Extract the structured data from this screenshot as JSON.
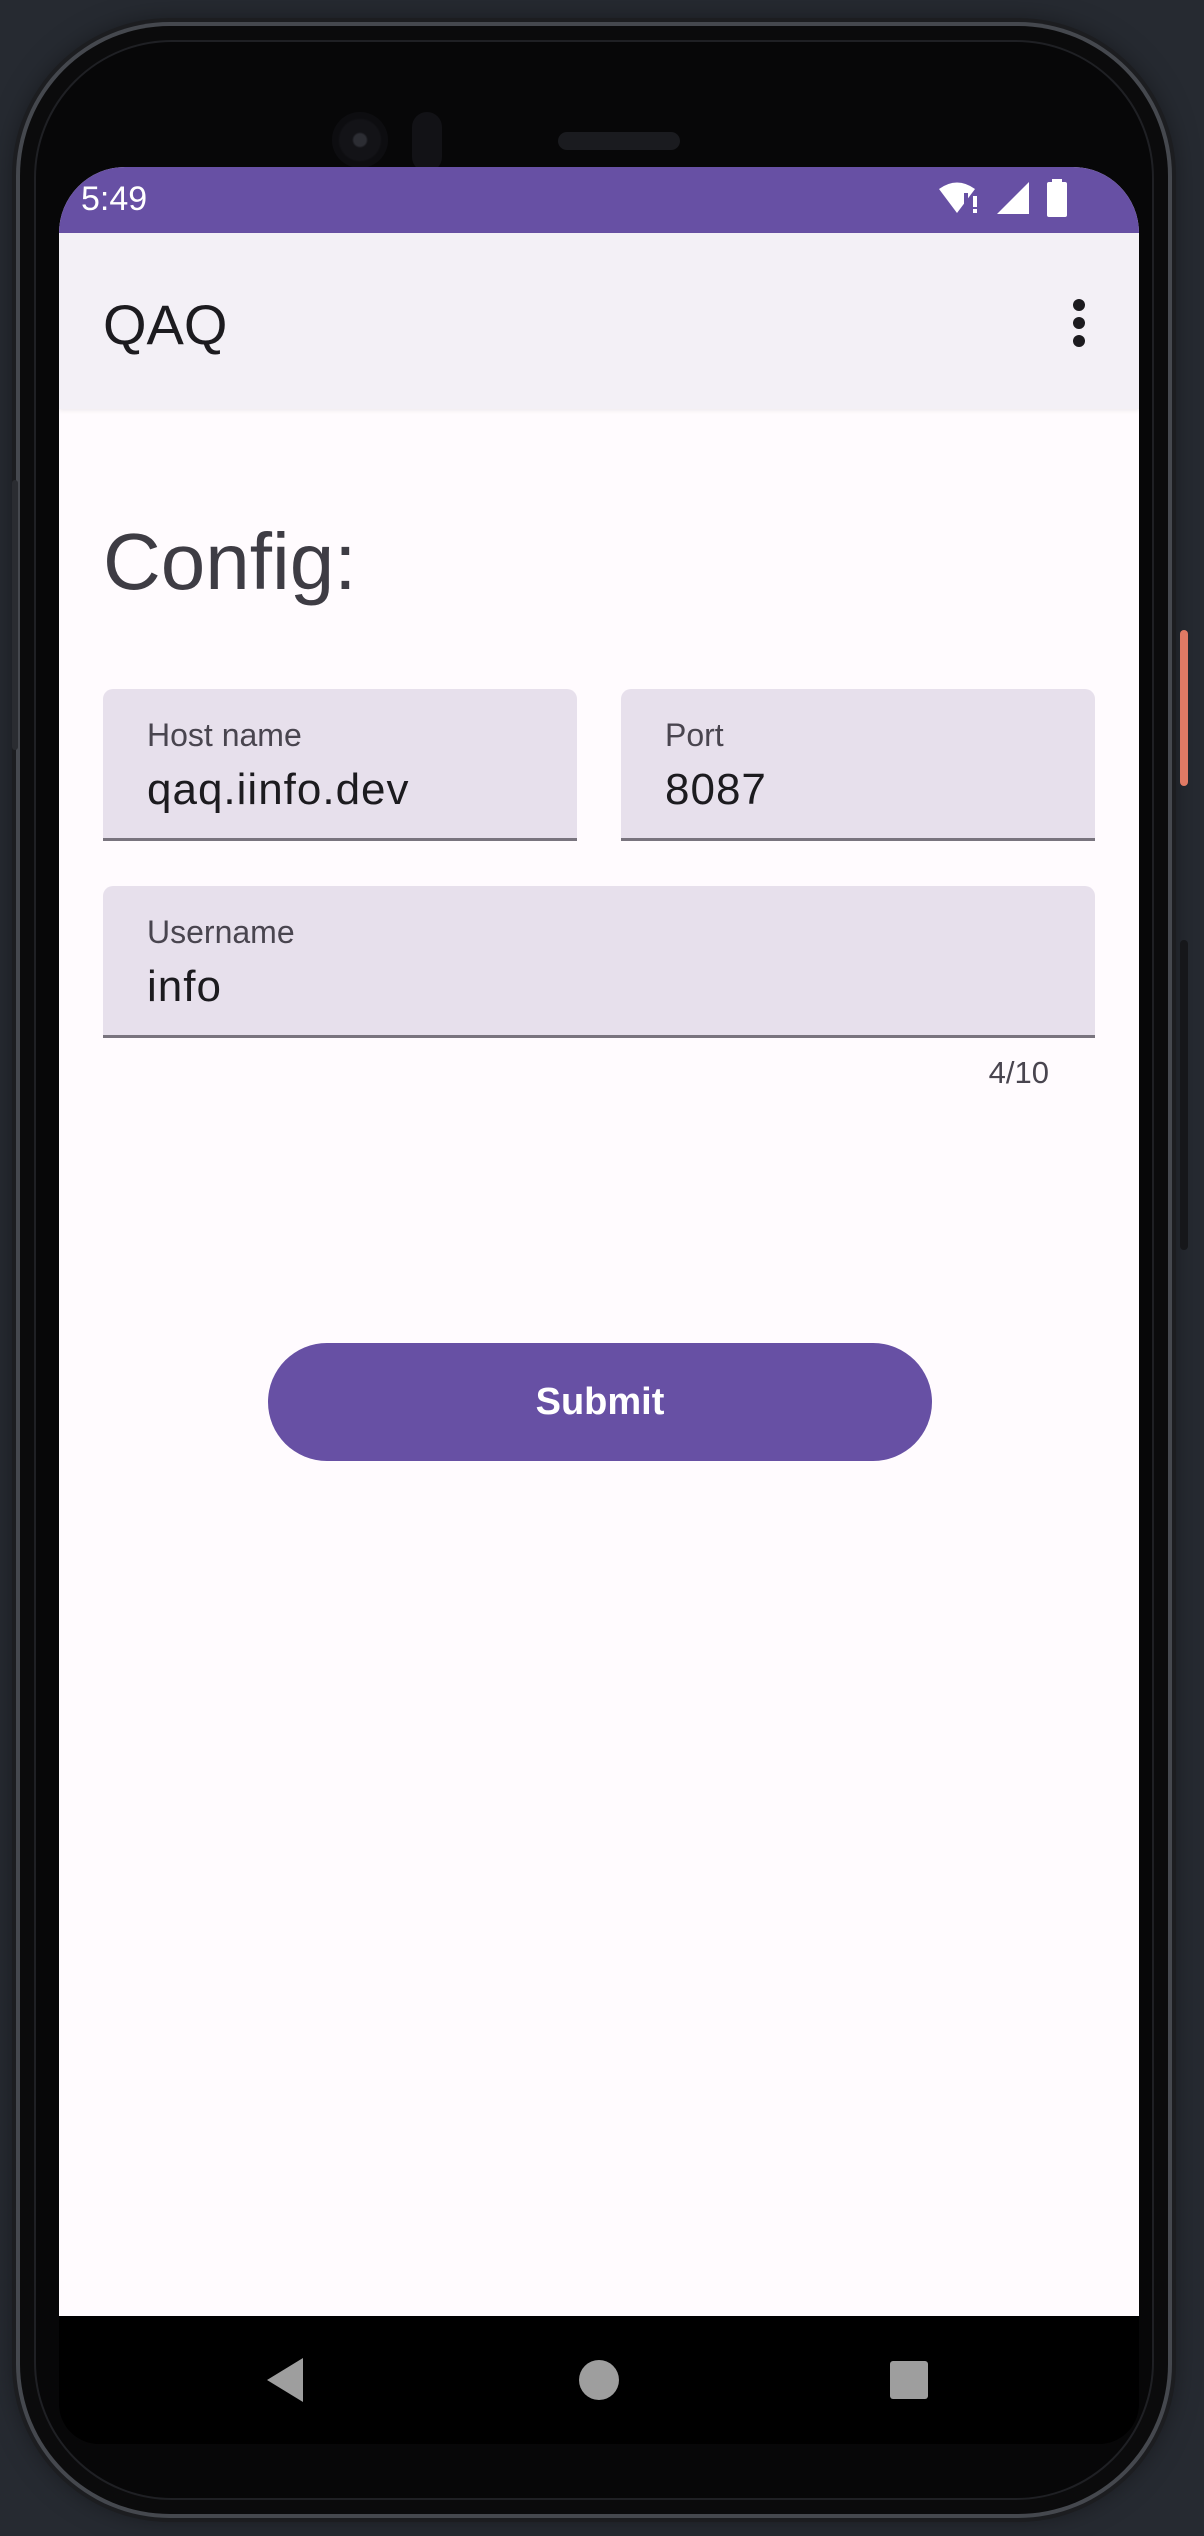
{
  "status_bar": {
    "time": "5:49",
    "icons": [
      "wifi-alert-icon",
      "cell-signal-icon",
      "battery-icon"
    ],
    "color": "#6750a4"
  },
  "app_bar": {
    "title": "QAQ",
    "menu_icon": "more-vert-icon"
  },
  "form": {
    "heading": "Config:",
    "host_field": {
      "label": "Host name",
      "value": "qaq.iinfo.dev"
    },
    "port_field": {
      "label": "Port",
      "value": "8087"
    },
    "username_field": {
      "label": "Username",
      "value": "info",
      "counter": "4/10"
    },
    "submit_label": "Submit"
  },
  "nav_bar": {
    "buttons": [
      "back-icon",
      "home-icon",
      "recents-icon"
    ]
  },
  "colors": {
    "primary": "#6750a4",
    "surface": "#fffbfe",
    "field_bg": "#e7e0ec",
    "app_bar_bg": "#f3f0f6"
  }
}
